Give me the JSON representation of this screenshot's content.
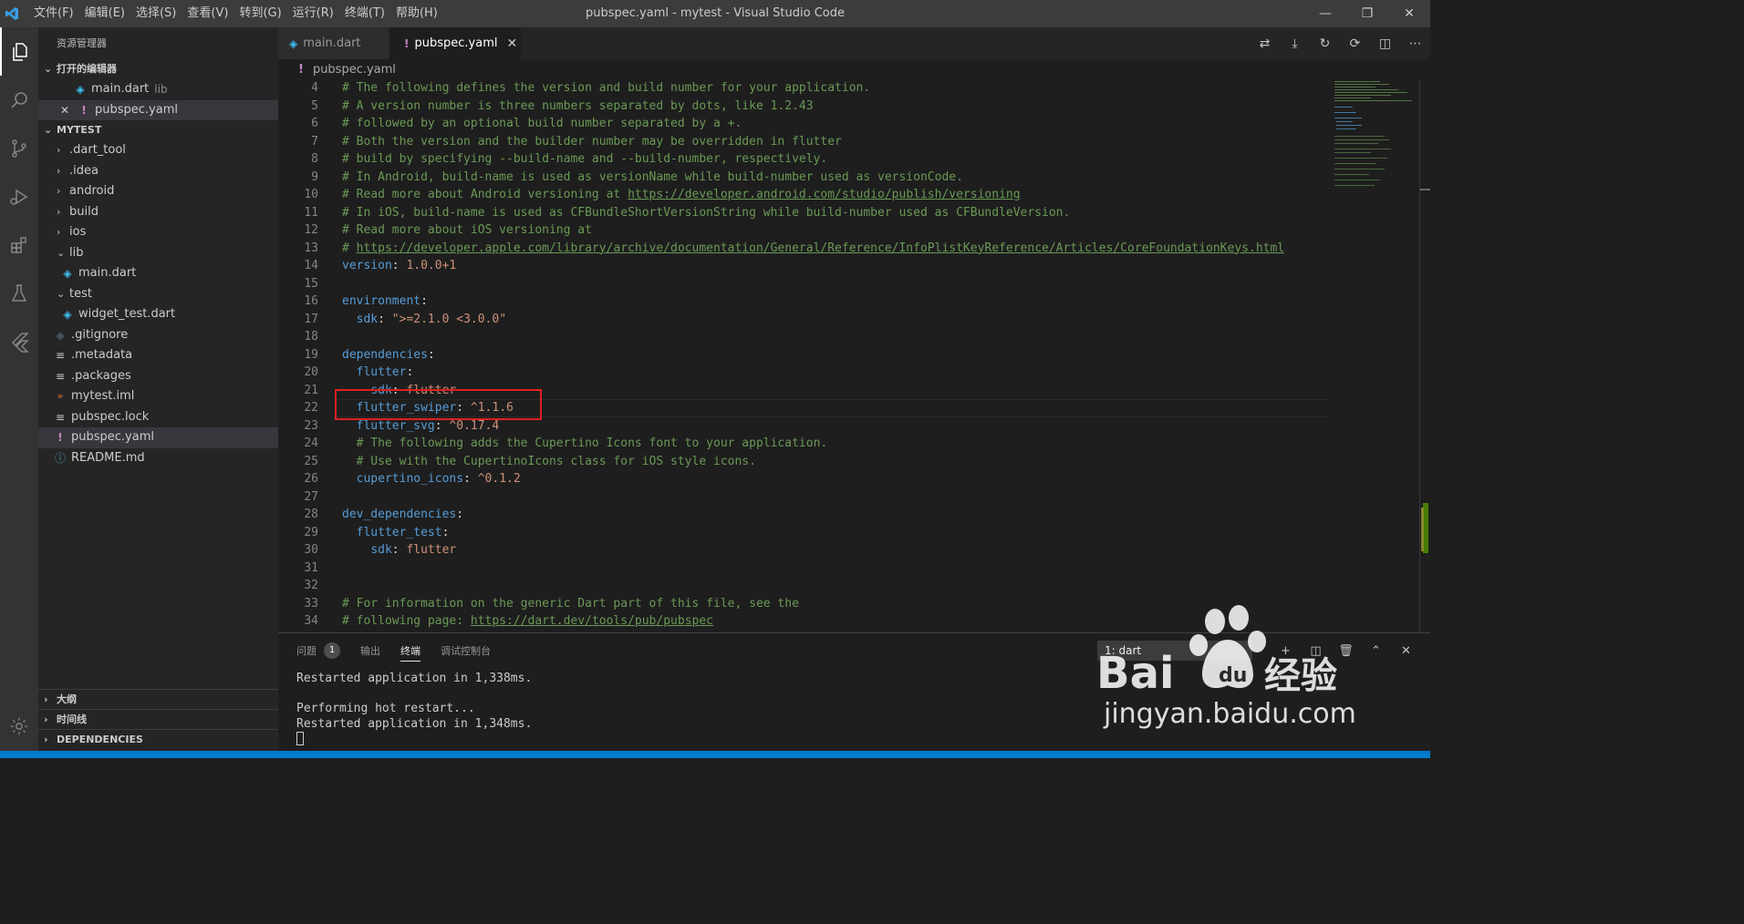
{
  "window": {
    "title": "pubspec.yaml - mytest - Visual Studio Code",
    "menu": [
      "文件(F)",
      "编辑(E)",
      "选择(S)",
      "查看(V)",
      "转到(G)",
      "运行(R)",
      "终端(T)",
      "帮助(H)"
    ]
  },
  "sidebar": {
    "title": "资源管理器",
    "open_editors": {
      "header": "打开的编辑器",
      "items": [
        {
          "name": "main.dart",
          "desc": "lib"
        },
        {
          "name": "pubspec.yaml",
          "desc": ""
        }
      ]
    },
    "project": {
      "header": "MYTEST",
      "items": [
        {
          "label": ".dart_tool",
          "type": "folder"
        },
        {
          "label": ".idea",
          "type": "folder"
        },
        {
          "label": "android",
          "type": "folder"
        },
        {
          "label": "build",
          "type": "folder"
        },
        {
          "label": "ios",
          "type": "folder"
        },
        {
          "label": "lib",
          "type": "folder-open"
        },
        {
          "label": "main.dart",
          "type": "dart"
        },
        {
          "label": "test",
          "type": "folder-open"
        },
        {
          "label": "widget_test.dart",
          "type": "dart"
        },
        {
          "label": ".gitignore",
          "type": "git"
        },
        {
          "label": ".metadata",
          "type": "text"
        },
        {
          "label": ".packages",
          "type": "text"
        },
        {
          "label": "mytest.iml",
          "type": "xml"
        },
        {
          "label": "pubspec.lock",
          "type": "text"
        },
        {
          "label": "pubspec.yaml",
          "type": "yaml"
        },
        {
          "label": "README.md",
          "type": "info"
        }
      ]
    },
    "bottom_sections": [
      "大纲",
      "时间线",
      "DEPENDENCIES"
    ]
  },
  "tabs": [
    {
      "label": "main.dart",
      "active": false
    },
    {
      "label": "pubspec.yaml",
      "active": true
    }
  ],
  "breadcrumb": "pubspec.yaml",
  "editor": {
    "lines": [
      {
        "n": "4",
        "text": "# The following defines the version and build number for your application."
      },
      {
        "n": "5",
        "text": "# A version number is three numbers separated by dots, like 1.2.43"
      },
      {
        "n": "6",
        "text": "# followed by an optional build number separated by a +."
      },
      {
        "n": "7",
        "text": "# Both the version and the builder number may be overridden in flutter"
      },
      {
        "n": "8",
        "text": "# build by specifying --build-name and --build-number, respectively."
      },
      {
        "n": "9",
        "text": "# In Android, build-name is used as versionName while build-number used as versionCode."
      },
      {
        "n": "10",
        "text": "# Read more about Android versioning at ",
        "url": "https://developer.android.com/studio/publish/versioning"
      },
      {
        "n": "11",
        "text": "# In iOS, build-name is used as CFBundleShortVersionString while build-number used as CFBundleVersion."
      },
      {
        "n": "12",
        "text": "# Read more about iOS versioning at"
      },
      {
        "n": "13",
        "text": "# ",
        "url": "https://developer.apple.com/library/archive/documentation/General/Reference/InfoPlistKeyReference/Articles/CoreFoundationKeys.html"
      },
      {
        "n": "14",
        "key": "version",
        "value": "1.0.0+1"
      },
      {
        "n": "15"
      },
      {
        "n": "16",
        "key": "environment",
        "value": ""
      },
      {
        "n": "17",
        "indent": "  ",
        "key": "sdk",
        "value": "\">=2.1.0 <3.0.0\""
      },
      {
        "n": "18"
      },
      {
        "n": "19",
        "key": "dependencies",
        "value": ""
      },
      {
        "n": "20",
        "indent": "  ",
        "key": "flutter",
        "value": ""
      },
      {
        "n": "21",
        "indent": "    ",
        "key": "sdk",
        "value": "flutter"
      },
      {
        "n": "22",
        "indent": "  ",
        "key": "flutter_swiper",
        "value": "^1.1.6"
      },
      {
        "n": "23",
        "indent": "  ",
        "key": "flutter_svg",
        "value": "^0.17.4"
      },
      {
        "n": "24",
        "indent": "  ",
        "text": "# The following adds the Cupertino Icons font to your application."
      },
      {
        "n": "25",
        "indent": "  ",
        "text": "# Use with the CupertinoIcons class for iOS style icons."
      },
      {
        "n": "26",
        "indent": "  ",
        "key": "cupertino_icons",
        "value": "^0.1.2"
      },
      {
        "n": "27"
      },
      {
        "n": "28",
        "key": "dev_dependencies",
        "value": ""
      },
      {
        "n": "29",
        "indent": "  ",
        "key": "flutter_test",
        "value": ""
      },
      {
        "n": "30",
        "indent": "    ",
        "key": "sdk",
        "value": "flutter"
      },
      {
        "n": "31"
      },
      {
        "n": "32"
      },
      {
        "n": "33",
        "text": "# For information on the generic Dart part of this file, see the"
      },
      {
        "n": "34",
        "text": "# following page: ",
        "url": "https://dart.dev/tools/pub/pubspec"
      }
    ]
  },
  "panel": {
    "tabs": [
      "问题",
      "输出",
      "终端",
      "调试控制台"
    ],
    "problems_count": "1",
    "terminal_select": "1: dart",
    "terminal_lines": [
      "Restarted application in 1,338ms.",
      "",
      "Performing hot restart...",
      "Restarted application in 1,348ms."
    ]
  },
  "watermark": {
    "brand": "Bai du 经验",
    "url": "jingyan.baidu.com"
  },
  "colors": {
    "accent": "#007acc",
    "highlight_box": "#e02020",
    "comment": "#6a9955",
    "key": "#569cd6",
    "string": "#ce9178"
  }
}
